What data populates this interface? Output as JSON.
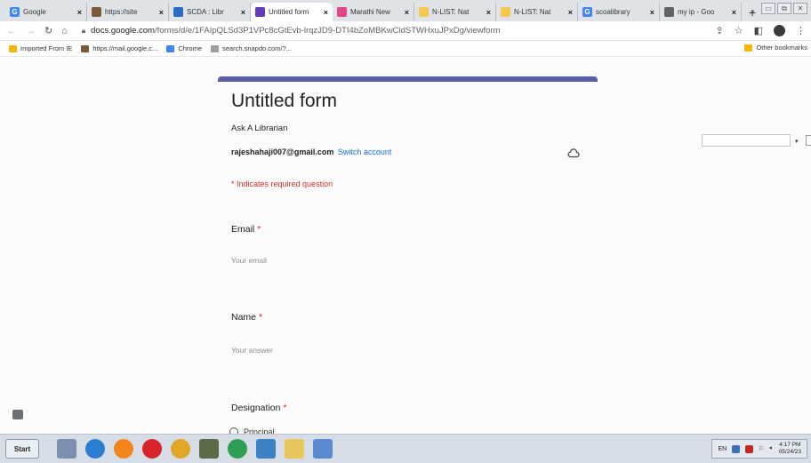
{
  "browser": {
    "tabs": [
      {
        "label": "Google",
        "color": "#4285f4",
        "glyph": "G",
        "active": false
      },
      {
        "label": "https://site",
        "color": "#7b5a3a",
        "glyph": "",
        "active": false
      },
      {
        "label": "SCDA : Libr",
        "color": "#2a6cc4",
        "glyph": "",
        "active": false
      },
      {
        "label": "Untitled form",
        "color": "#673ab7",
        "glyph": "",
        "active": true
      },
      {
        "label": "Marathi New",
        "color": "#e0468a",
        "glyph": "",
        "active": false
      },
      {
        "label": "N-LIST: Nat",
        "color": "#f2c94c",
        "glyph": "",
        "active": false
      },
      {
        "label": "N-LIST: Nat",
        "color": "#f2c94c",
        "glyph": "",
        "active": false
      },
      {
        "label": "scoalibrary",
        "color": "#4285f4",
        "glyph": "G",
        "active": false
      },
      {
        "label": "my ip - Goo",
        "color": "#5f6368",
        "glyph": "",
        "active": false
      }
    ],
    "new_tab": "+",
    "url_host": "docs.google.com",
    "url_path": "/forms/d/e/1FAIpQLSd3P1VPc8cGtEvb-lrqzJD9-DTI4bZoMBKwCldSTWHxuJPxDg/viewform",
    "bookmarks": [
      {
        "label": "Imported From IE",
        "color": "#f2b705"
      },
      {
        "label": "https://mail.google.c...",
        "color": "#7b5a3a"
      },
      {
        "label": "Chrome",
        "color": "#4285f4"
      },
      {
        "label": "search.snapdo.com/?...",
        "color": "#9aa0a6"
      }
    ],
    "other_bookmarks": "Other bookmarks"
  },
  "form": {
    "title": "Untitled form",
    "description": "Ask A Librarian",
    "account_email": "rajeshahaji007@gmail.com",
    "switch_account": "Switch account",
    "required_note": "* Indicates required question",
    "accent_color": "#5b5ea6",
    "questions": [
      {
        "label": "Email",
        "placeholder": "Your email"
      },
      {
        "label": "Name",
        "placeholder": "Your answer"
      },
      {
        "label": "Designation",
        "options": [
          "Principal"
        ]
      }
    ],
    "required_star": "*"
  },
  "taskbar": {
    "start_label": "Start",
    "lang": "EN",
    "time": "4:17 PM",
    "date": "05/24/23"
  }
}
